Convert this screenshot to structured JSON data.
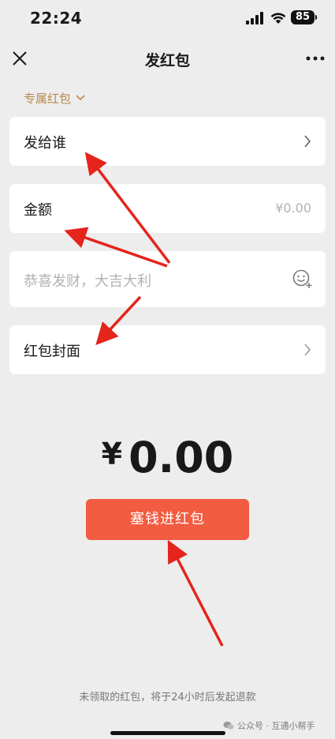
{
  "status_bar": {
    "time": "22:24",
    "battery": "85"
  },
  "nav": {
    "title": "发红包"
  },
  "packet_type": {
    "label": "专属红包"
  },
  "recipient": {
    "label": "发给谁"
  },
  "amount": {
    "label": "金额",
    "value": "¥0.00"
  },
  "greeting": {
    "placeholder": "恭喜发财，大吉大利"
  },
  "cover": {
    "label": "红包封面"
  },
  "total": {
    "currency": "¥",
    "value": "0.00"
  },
  "submit": {
    "label": "塞钱进红包"
  },
  "footer": {
    "note": "未领取的红包，将于24小时后发起退款"
  },
  "watermark": {
    "text": "公众号 · 互通小帮手"
  },
  "colors": {
    "background": "#ededed",
    "accent": "#f25c41",
    "gold": "#b8894a",
    "annotation_red": "#e5241b"
  }
}
